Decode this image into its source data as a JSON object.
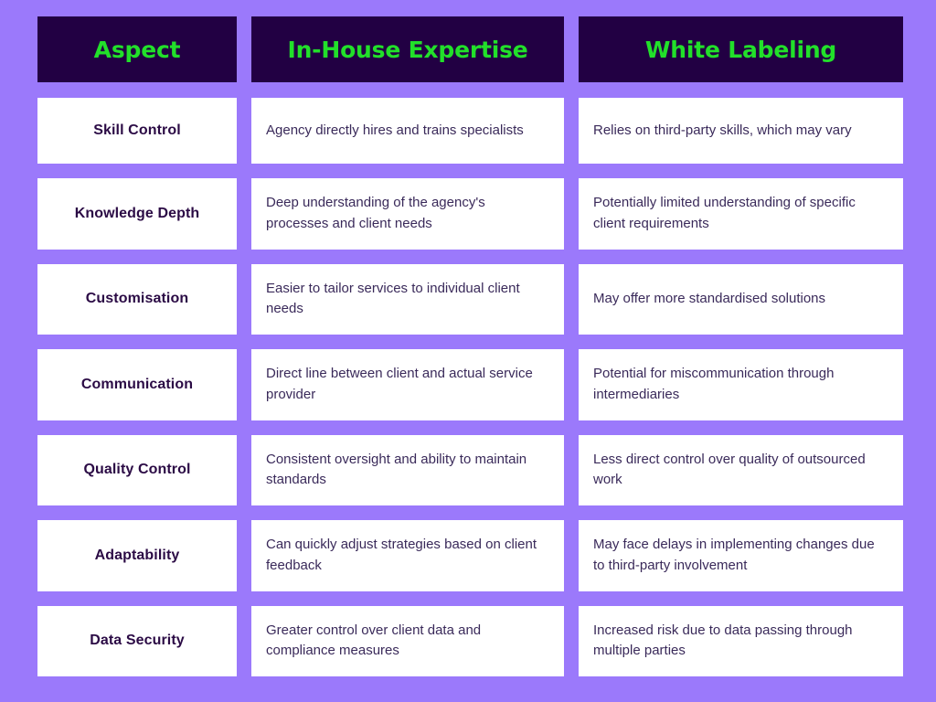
{
  "theme": {
    "page_background": "#9b79fb",
    "header_background": "#220043",
    "header_text_color": "#22e02a",
    "cell_background": "#ffffff",
    "aspect_text_color": "#2b0b45",
    "body_text_color": "#3a2a5a"
  },
  "table": {
    "headers": [
      "Aspect",
      "In-House Expertise",
      "White Labeling"
    ],
    "rows": [
      {
        "aspect": "Skill Control",
        "in_house": "Agency directly hires and trains specialists",
        "white_label": "Relies on third-party skills, which may vary"
      },
      {
        "aspect": "Knowledge Depth",
        "in_house": "Deep understanding of the agency's processes and client needs",
        "white_label": "Potentially limited understanding of specific client requirements"
      },
      {
        "aspect": "Customisation",
        "in_house": "Easier to tailor services to individual client needs",
        "white_label": "May offer more standardised solutions"
      },
      {
        "aspect": "Communication",
        "in_house": "Direct line between client and actual service provider",
        "white_label": "Potential for miscommunication through intermediaries"
      },
      {
        "aspect": "Quality Control",
        "in_house": "Consistent oversight and ability to maintain standards",
        "white_label": "Less direct control over quality of outsourced work"
      },
      {
        "aspect": "Adaptability",
        "in_house": "Can quickly adjust strategies based on client feedback",
        "white_label": "May face delays in implementing changes due to third-party involvement"
      },
      {
        "aspect": "Data Security",
        "in_house": "Greater control over client data and compliance measures",
        "white_label": "Increased risk due to data passing through multiple parties"
      }
    ]
  }
}
